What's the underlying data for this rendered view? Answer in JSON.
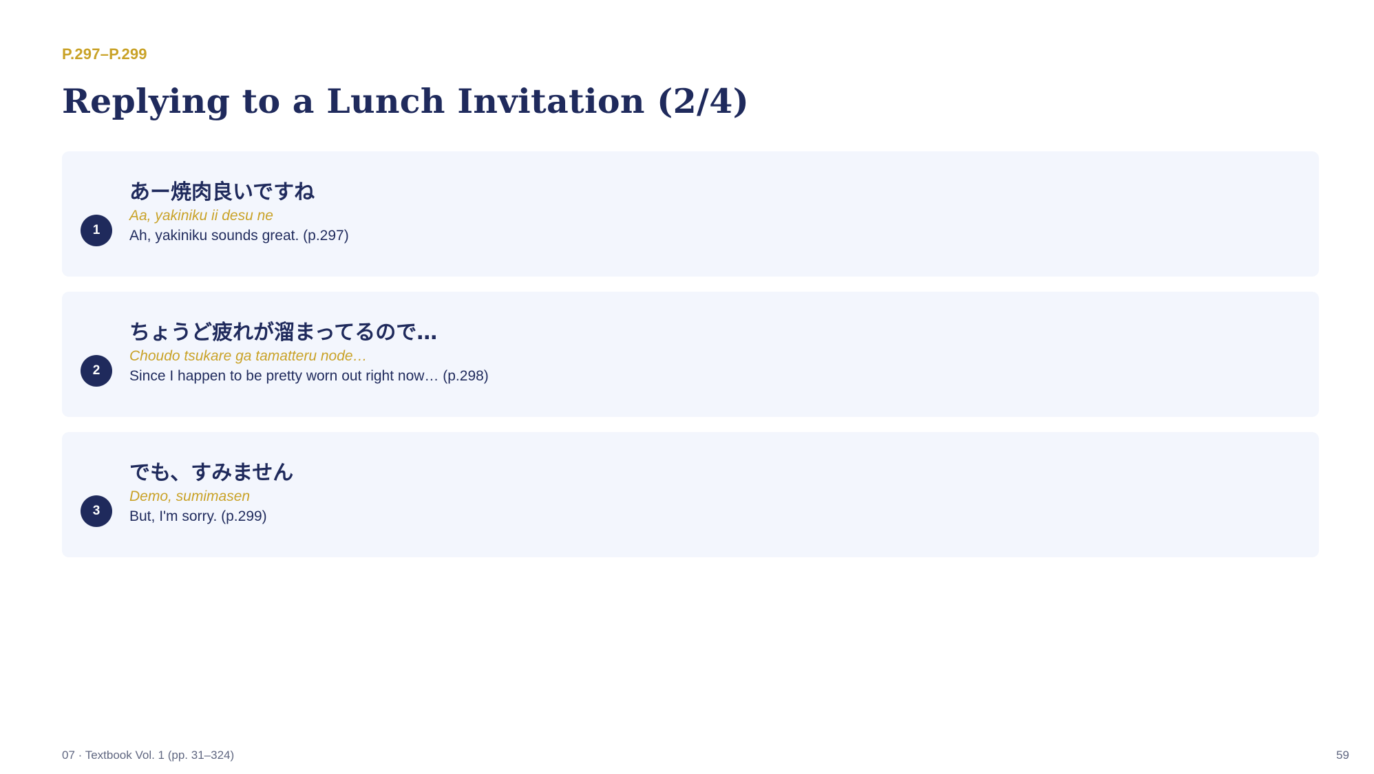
{
  "header": {
    "page_range": "P.297–P.299",
    "title": "Replying to a Lunch Invitation (2/4)"
  },
  "phrases": [
    {
      "number": "1",
      "japanese": "あー焼肉良いですね",
      "romaji": "Aa, yakiniku ii desu ne",
      "english": "Ah, yakiniku sounds great. (p.297)"
    },
    {
      "number": "2",
      "japanese": "ちょうど疲れが溜まってるので…",
      "romaji": "Choudo tsukare ga tamatteru node…",
      "english": "Since I happen to be pretty worn out right now… (p.298)"
    },
    {
      "number": "3",
      "japanese": "でも、すみません",
      "romaji": "Demo, sumimasen",
      "english": "But, I'm sorry. (p.299)"
    }
  ],
  "footer": {
    "source": "07 · Textbook Vol. 1 (pp. 31–324)",
    "page_number": "59"
  },
  "colors": {
    "navy": "#1f2a5c",
    "gold": "#c9a227",
    "card_background": "#f3f6fd"
  }
}
